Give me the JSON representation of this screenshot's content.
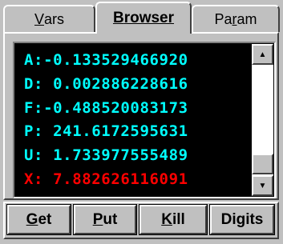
{
  "tabs": [
    {
      "label_pre": "",
      "label_u": "V",
      "label_post": "ars"
    },
    {
      "label_pre": "",
      "label_u": "B",
      "label_post": "rowser"
    },
    {
      "label_pre": "Pa",
      "label_u": "r",
      "label_post": "am"
    }
  ],
  "display": {
    "lines": [
      {
        "text": "A:-0.133529466920",
        "color": "#00ffff"
      },
      {
        "text": "D: 0.002886228616",
        "color": "#00ffff"
      },
      {
        "text": "F:-0.488520083173",
        "color": "#00ffff"
      },
      {
        "text": "P: 241.6172595631",
        "color": "#00ffff"
      },
      {
        "text": "U: 1.733977555489",
        "color": "#00ffff"
      },
      {
        "text": "X: 7.882626116091",
        "color": "#ff0000"
      }
    ]
  },
  "scrollbar": {
    "up_icon": "triangle-up",
    "down_icon": "triangle-down"
  },
  "buttons": [
    {
      "u": "G",
      "rest": "et"
    },
    {
      "u": "P",
      "rest": "ut"
    },
    {
      "u": "K",
      "rest": "ill"
    },
    {
      "pre": "Di",
      "u": "g",
      "rest": "its"
    }
  ]
}
